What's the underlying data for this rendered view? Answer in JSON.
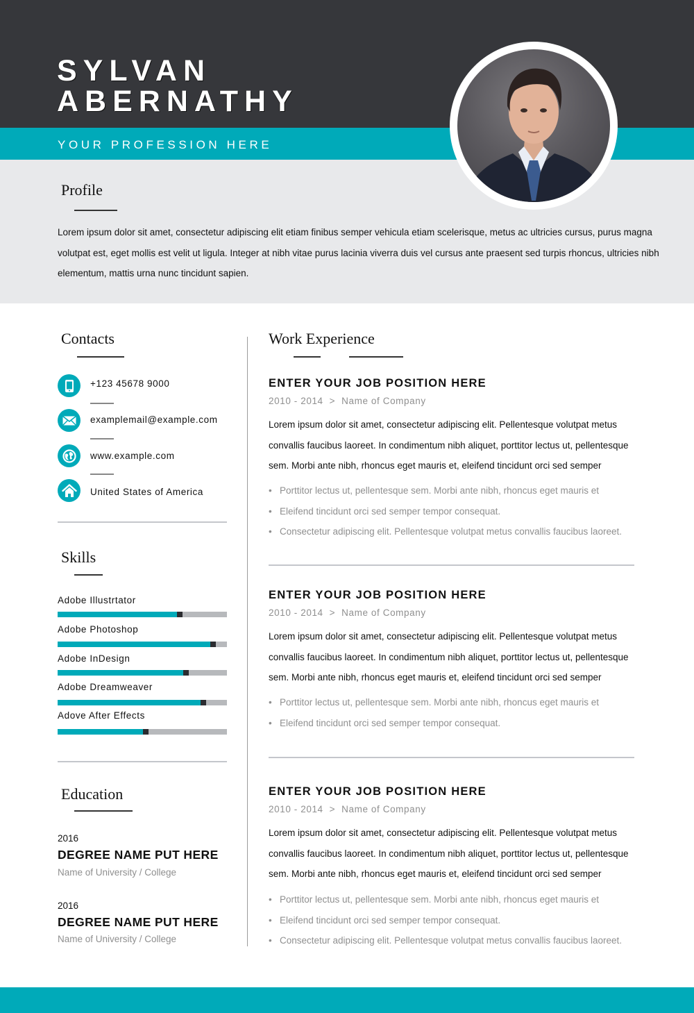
{
  "header": {
    "first_name": "SYLVAN",
    "last_name": "ABERNATHY",
    "profession": "YOUR PROFESSION HERE",
    "photo_alt": "Portrait photo of a man in a dark suit and blue tie",
    "colors": {
      "dark": "#36373b",
      "accent": "#00aab9",
      "band": "#e8e9eb"
    }
  },
  "profile": {
    "title": "Profile",
    "text": "Lorem ipsum dolor sit amet, consectetur adipiscing elit etiam finibus semper vehicula etiam scelerisque, metus ac ultricies cursus, purus magna volutpat est, eget mollis est velit ut ligula. Integer at nibh vitae purus lacinia viverra duis vel cursus ante praesent sed turpis rhoncus, ultricies nibh elementum, mattis urna nunc tincidunt sapien."
  },
  "contacts": {
    "title": "Contacts",
    "items": [
      {
        "icon": "phone-icon",
        "text": "+123 45678 9000"
      },
      {
        "icon": "mail-icon",
        "text": "examplemail@example.com"
      },
      {
        "icon": "globe-icon",
        "text": "www.example.com"
      },
      {
        "icon": "home-icon",
        "text": "United States of America"
      }
    ]
  },
  "skills": {
    "title": "Skills",
    "items": [
      {
        "label": "Adobe Illustrtator",
        "level": 0.72
      },
      {
        "label": "Adobe Photoshop",
        "level": 0.92
      },
      {
        "label": "Adobe InDesign",
        "level": 0.76
      },
      {
        "label": "Adobe Dreamweaver",
        "level": 0.86
      },
      {
        "label": "Adove After Effects",
        "level": 0.52
      }
    ]
  },
  "education": {
    "title": "Education",
    "items": [
      {
        "year": "2016",
        "degree": "DEGREE NAME PUT HERE",
        "school": "Name of University / College"
      },
      {
        "year": "2016",
        "degree": "DEGREE NAME PUT HERE",
        "school": "Name of University / College"
      }
    ]
  },
  "work": {
    "title": "Work Experience",
    "jobs": [
      {
        "title": "ENTER YOUR JOB POSITION HERE",
        "dates": "2010 - 2014",
        "separator": ">",
        "company": "Name of Company",
        "description": "Lorem ipsum dolor sit amet, consectetur adipiscing elit. Pellentesque volutpat metus convallis faucibus laoreet. In condimentum nibh aliquet, porttitor lectus ut, pellentesque sem. Morbi ante nibh, rhoncus eget mauris et, eleifend tincidunt orci sed semper",
        "bullets": [
          "Porttitor lectus ut, pellentesque sem. Morbi ante nibh, rhoncus eget mauris et",
          "Eleifend tincidunt orci sed semper tempor consequat.",
          "Consectetur adipiscing elit. Pellentesque volutpat metus convallis faucibus laoreet."
        ]
      },
      {
        "title": "ENTER YOUR JOB POSITION HERE",
        "dates": "2010 - 2014",
        "separator": ">",
        "company": "Name of Company",
        "description": "Lorem ipsum dolor sit amet, consectetur adipiscing elit. Pellentesque volutpat metus convallis faucibus laoreet. In condimentum nibh aliquet, porttitor lectus ut, pellentesque sem. Morbi ante nibh, rhoncus eget mauris et, eleifend tincidunt orci sed semper",
        "bullets": [
          "Porttitor lectus ut, pellentesque sem. Morbi ante nibh, rhoncus eget mauris et",
          "Eleifend tincidunt orci sed semper tempor consequat."
        ]
      },
      {
        "title": "ENTER YOUR JOB POSITION HERE",
        "dates": "2010 - 2014",
        "separator": ">",
        "company": "Name of Company",
        "description": "Lorem ipsum dolor sit amet, consectetur adipiscing elit. Pellentesque volutpat metus convallis faucibus laoreet. In condimentum nibh aliquet, porttitor lectus ut, pellentesque sem. Morbi ante nibh, rhoncus eget mauris et, eleifend tincidunt orci sed semper",
        "bullets": [
          "Porttitor lectus ut, pellentesque sem. Morbi ante nibh, rhoncus eget mauris et",
          "Eleifend tincidunt orci sed semper tempor consequat.",
          "Consectetur adipiscing elit. Pellentesque volutpat metus convallis faucibus laoreet."
        ]
      }
    ]
  }
}
